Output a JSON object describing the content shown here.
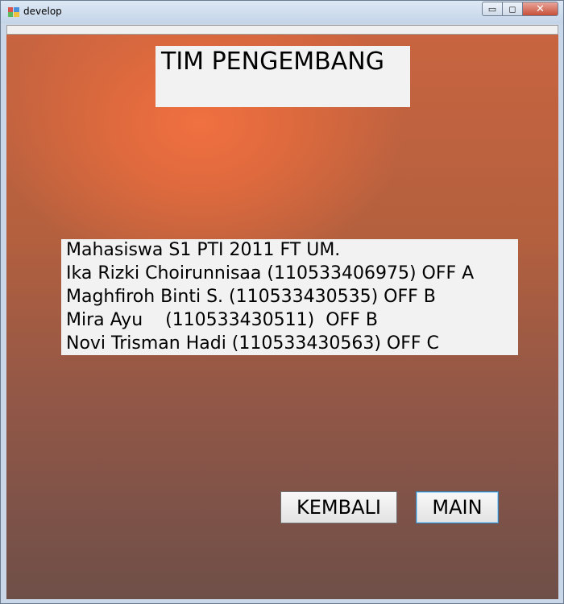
{
  "window": {
    "title": "develop",
    "controls": {
      "minimize_glyph": "▭",
      "maximize_glyph": "◻",
      "close_glyph": "✕"
    }
  },
  "form": {
    "heading": "TIM PENGEMBANG",
    "info_lines": [
      "Mahasiswa S1 PTI 2011 FT UM.",
      "Ika Rizki Choirunnisaa (110533406975) OFF A",
      "Maghfiroh Binti S. (110533430535) OFF B",
      "Mira Ayu    (110533430511)  OFF B",
      "Novi Trisman Hadi (110533430563) OFF C"
    ],
    "buttons": {
      "kembali": "KEMBALI",
      "main": "MAIN"
    }
  },
  "colors": {
    "client_top": "#e06a3e",
    "client_bottom": "#6e4f48",
    "close_button": "#c8503a"
  },
  "icons": {
    "app": "app-window-icon",
    "minimize": "minimize-icon",
    "maximize": "maximize-icon",
    "close": "close-icon"
  }
}
